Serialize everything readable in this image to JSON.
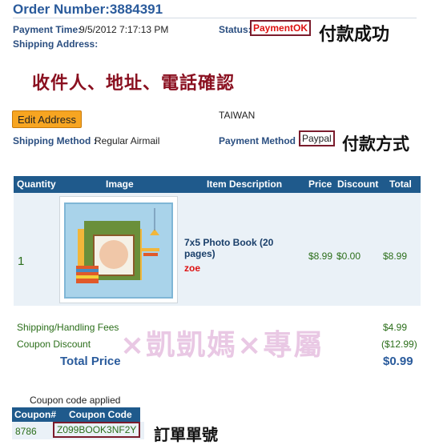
{
  "order": {
    "title": "Order Number:3884391",
    "payment_time_label": "Payment Time:",
    "payment_time_value": "9/5/2012 7:17:13 PM",
    "status_label": "Status:",
    "status_value": "PaymentOK",
    "status_note": "付款成功",
    "shipping_address_label": "Shipping Address:",
    "address_note": "收件人、地址、電話確認",
    "country": "TAIWAN",
    "edit_address_label": "Edit Address",
    "shipping_method_label": "Shipping Method :",
    "shipping_method_value": "Regular Airmail",
    "payment_method_label": "Payment Method :",
    "payment_method_value": "Paypal",
    "payment_method_note": "付款方式"
  },
  "table": {
    "headers": [
      "Quantity",
      "Image",
      "Item Description",
      "Price",
      "Discount",
      "Total"
    ],
    "row": {
      "quantity": "1",
      "description": "7x5 Photo Book (20 pages)",
      "sub": "zoe",
      "price": "$8.99",
      "discount": "$0.00",
      "total": "$8.99"
    }
  },
  "summary": {
    "shipping_label": "Shipping/Handling Fees",
    "shipping_value": "$4.99",
    "coupon_label": "Coupon Discount",
    "coupon_value": "($12.99)",
    "total_label": "Total Price",
    "total_value": "$0.99"
  },
  "watermark": "×凱凱媽×專屬",
  "coupon": {
    "applied_label": "Coupon code applied",
    "headers": [
      "Coupon#",
      "Coupon Code"
    ],
    "number": "8786",
    "code": "Z099BOOK3NF2Y",
    "note": "訂單單號"
  },
  "colors": {
    "header_blue": "#1f5a8c",
    "title_blue": "#2a5b9c",
    "status_red": "#dd1111",
    "box_border": "#7b1c2c",
    "button_orange": "#f7a521",
    "money_green": "#2b6e1a"
  }
}
